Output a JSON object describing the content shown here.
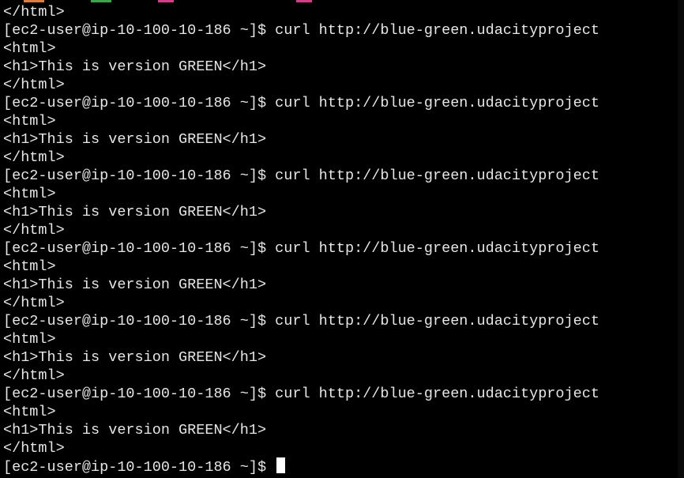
{
  "tabstrip": {
    "accent_colors": [
      "#e07b39",
      "#3aa64a",
      "#d83b8a",
      "#d83b8a"
    ]
  },
  "terminal": {
    "lines": [
      "</html>",
      "[ec2-user@ip-10-100-10-186 ~]$ curl http://blue-green.udacityproject",
      "<html>",
      "<h1>This is version GREEN</h1>",
      "</html>",
      "[ec2-user@ip-10-100-10-186 ~]$ curl http://blue-green.udacityproject",
      "<html>",
      "<h1>This is version GREEN</h1>",
      "</html>",
      "[ec2-user@ip-10-100-10-186 ~]$ curl http://blue-green.udacityproject",
      "<html>",
      "<h1>This is version GREEN</h1>",
      "</html>",
      "[ec2-user@ip-10-100-10-186 ~]$ curl http://blue-green.udacityproject",
      "<html>",
      "<h1>This is version GREEN</h1>",
      "</html>",
      "[ec2-user@ip-10-100-10-186 ~]$ curl http://blue-green.udacityproject",
      "<html>",
      "<h1>This is version GREEN</h1>",
      "</html>",
      "[ec2-user@ip-10-100-10-186 ~]$ curl http://blue-green.udacityproject",
      "<html>",
      "<h1>This is version GREEN</h1>",
      "</html>"
    ],
    "prompt": "[ec2-user@ip-10-100-10-186 ~]$ "
  }
}
